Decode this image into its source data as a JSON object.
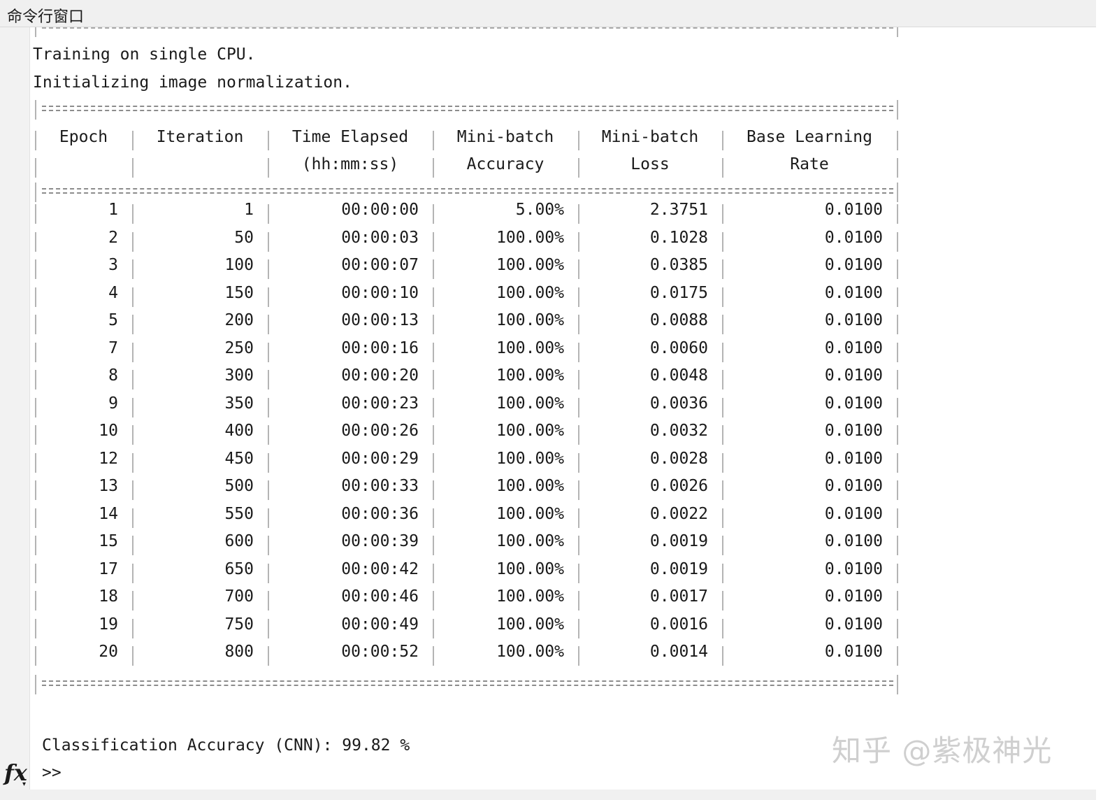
{
  "window": {
    "title": "命令行窗口"
  },
  "console": {
    "messages": [
      "Training on single CPU.",
      "Initializing image normalization."
    ],
    "table": {
      "headers": [
        [
          "Epoch",
          ""
        ],
        [
          "Iteration",
          ""
        ],
        [
          "Time Elapsed",
          "(hh:mm:ss)"
        ],
        [
          "Mini-batch",
          "Accuracy"
        ],
        [
          "Mini-batch",
          "Loss"
        ],
        [
          "Base Learning",
          "Rate"
        ]
      ],
      "rows": [
        [
          "1",
          "1",
          "00:00:00",
          "5.00%",
          "2.3751",
          "0.0100"
        ],
        [
          "2",
          "50",
          "00:00:03",
          "100.00%",
          "0.1028",
          "0.0100"
        ],
        [
          "3",
          "100",
          "00:00:07",
          "100.00%",
          "0.0385",
          "0.0100"
        ],
        [
          "4",
          "150",
          "00:00:10",
          "100.00%",
          "0.0175",
          "0.0100"
        ],
        [
          "5",
          "200",
          "00:00:13",
          "100.00%",
          "0.0088",
          "0.0100"
        ],
        [
          "7",
          "250",
          "00:00:16",
          "100.00%",
          "0.0060",
          "0.0100"
        ],
        [
          "8",
          "300",
          "00:00:20",
          "100.00%",
          "0.0048",
          "0.0100"
        ],
        [
          "9",
          "350",
          "00:00:23",
          "100.00%",
          "0.0036",
          "0.0100"
        ],
        [
          "10",
          "400",
          "00:00:26",
          "100.00%",
          "0.0032",
          "0.0100"
        ],
        [
          "12",
          "450",
          "00:00:29",
          "100.00%",
          "0.0028",
          "0.0100"
        ],
        [
          "13",
          "500",
          "00:00:33",
          "100.00%",
          "0.0026",
          "0.0100"
        ],
        [
          "14",
          "550",
          "00:00:36",
          "100.00%",
          "0.0022",
          "0.0100"
        ],
        [
          "15",
          "600",
          "00:00:39",
          "100.00%",
          "0.0019",
          "0.0100"
        ],
        [
          "17",
          "650",
          "00:00:42",
          "100.00%",
          "0.0019",
          "0.0100"
        ],
        [
          "18",
          "700",
          "00:00:46",
          "100.00%",
          "0.0017",
          "0.0100"
        ],
        [
          "19",
          "750",
          "00:00:49",
          "100.00%",
          "0.0016",
          "0.0100"
        ],
        [
          "20",
          "800",
          "00:00:52",
          "100.00%",
          "0.0014",
          "0.0100"
        ]
      ]
    },
    "result": "Classification Accuracy (CNN): 99.82 %",
    "prompt": ">>"
  },
  "icons": {
    "function": "fx-icon"
  },
  "watermark": "知乎 @紫极神光"
}
